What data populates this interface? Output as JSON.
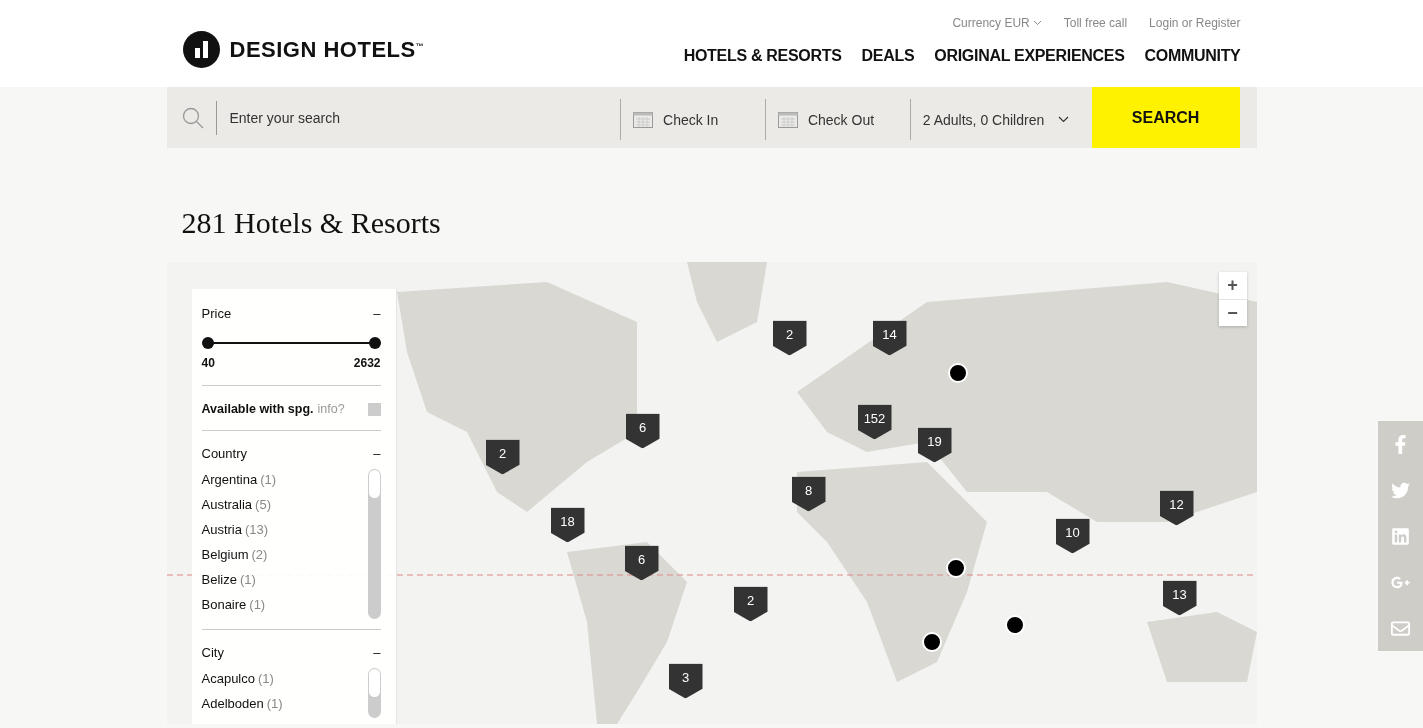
{
  "header": {
    "logo": "DESIGN HOTELS$^{™}$",
    "top_links": [
      {
        "label": "Currency EUR",
        "kind": "dropdown"
      },
      {
        "label": "Toll free call",
        "kind": "link"
      },
      {
        "label": "Login or Register",
        "kind": "link"
      }
    ],
    "nav": [
      "HOTELS & RESORTS",
      "DEALS",
      "ORIGINAL EXPERIENCES",
      "COMMUNITY"
    ]
  },
  "search_bar": {
    "placeholder": "Enter your search",
    "check_in": "Check In",
    "check_out": "Check Out",
    "guests": "2 Adults, 0 Children",
    "button": "SEARCH"
  },
  "title": "281 Hotels & Resorts",
  "filters": {
    "price": {
      "label": "Price",
      "toggle": "–",
      "thumbs": [
        {
          "level": 0
        },
        {
          "level": 1
        }
      ],
      "min": "40",
      "max": "2632"
    },
    "spg": {
      "label": "Available with spg.",
      "info": "info?",
      "checked": false
    },
    "country": {
      "label": "Country",
      "toggle": "–",
      "items": [
        {
          "name": "Argentina",
          "count": "(1)"
        },
        {
          "name": "Australia",
          "count": "(5)"
        },
        {
          "name": "Austria",
          "count": "(13)"
        },
        {
          "name": "Belgium",
          "count": "(2)"
        },
        {
          "name": "Belize",
          "count": "(1)"
        },
        {
          "name": "Bonaire",
          "count": "(1)"
        }
      ]
    },
    "city": {
      "label": "City",
      "toggle": "–",
      "items": [
        {
          "name": "Acapulco",
          "count": "(1)"
        },
        {
          "name": "Adelboden",
          "count": "(1)"
        }
      ]
    }
  },
  "map": {
    "zoom_in": "+",
    "zoom_out": "−",
    "markers": [
      {
        "kind": "cluster",
        "count": "2"
      },
      {
        "kind": "cluster",
        "count": "14"
      },
      {
        "kind": "cluster",
        "count": "152"
      },
      {
        "kind": "cluster",
        "count": "19"
      },
      {
        "kind": "cluster",
        "count": "6"
      },
      {
        "kind": "cluster",
        "count": "2"
      },
      {
        "kind": "cluster",
        "count": "8"
      },
      {
        "kind": "cluster",
        "count": "18"
      },
      {
        "kind": "cluster",
        "count": "6"
      },
      {
        "kind": "cluster",
        "count": "2"
      },
      {
        "kind": "cluster",
        "count": "3"
      },
      {
        "kind": "cluster",
        "count": "10"
      },
      {
        "kind": "cluster",
        "count": "12"
      },
      {
        "kind": "cluster",
        "count": "13"
      },
      {
        "kind": "hotel"
      },
      {
        "kind": "hotel"
      },
      {
        "kind": "hotel"
      },
      {
        "kind": "hotel"
      }
    ]
  },
  "social": [
    {
      "kind": "facebook"
    },
    {
      "kind": "twitter"
    },
    {
      "kind": "linkedin"
    },
    {
      "kind": "googleplus"
    },
    {
      "kind": "email"
    }
  ]
}
